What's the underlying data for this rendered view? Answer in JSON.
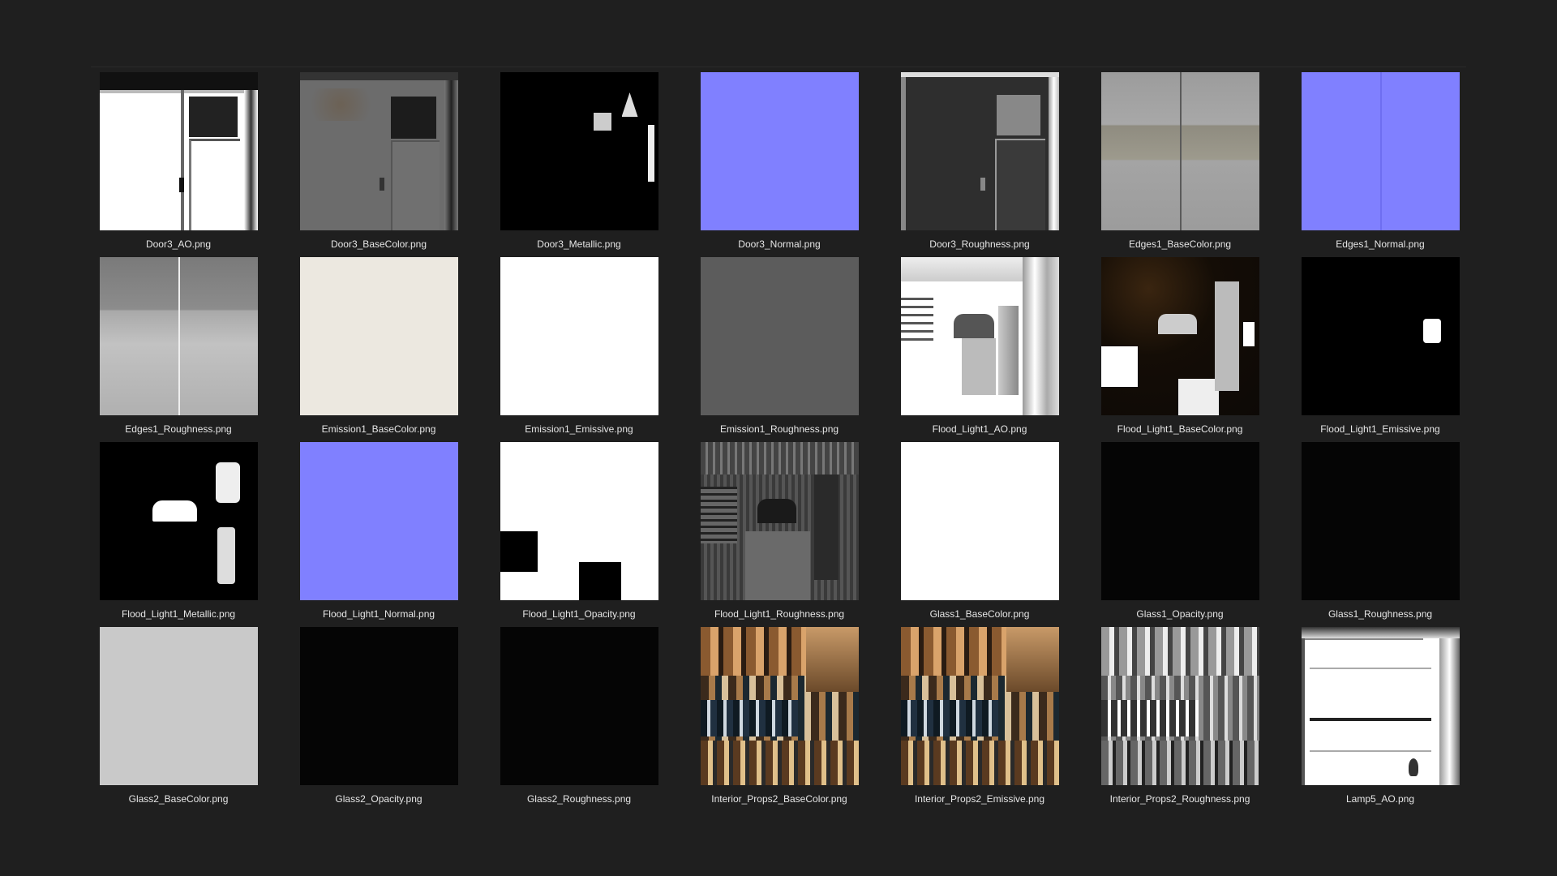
{
  "gallery": {
    "items": [
      {
        "name": "Door3_AO.png",
        "look": "door-ao"
      },
      {
        "name": "Door3_BaseColor.png",
        "look": "door-base"
      },
      {
        "name": "Door3_Metallic.png",
        "look": "door-metal"
      },
      {
        "name": "Door3_Normal.png",
        "look": "normal"
      },
      {
        "name": "Door3_Roughness.png",
        "look": "door-rough"
      },
      {
        "name": "Edges1_BaseColor.png",
        "look": "concrete"
      },
      {
        "name": "Edges1_Normal.png",
        "look": "normal-line"
      },
      {
        "name": "Edges1_Roughness.png",
        "look": "rough-concrete"
      },
      {
        "name": "Emission1_BaseColor.png",
        "look": "cream"
      },
      {
        "name": "Emission1_Emissive.png",
        "look": "white"
      },
      {
        "name": "Emission1_Roughness.png",
        "look": "midgray"
      },
      {
        "name": "Flood_Light1_AO.png",
        "look": "flood-ao"
      },
      {
        "name": "Flood_Light1_BaseColor.png",
        "look": "flood-base"
      },
      {
        "name": "Flood_Light1_Emissive.png",
        "look": "flood-emissive"
      },
      {
        "name": "Flood_Light1_Metallic.png",
        "look": "flood-metal"
      },
      {
        "name": "Flood_Light1_Normal.png",
        "look": "normal"
      },
      {
        "name": "Flood_Light1_Opacity.png",
        "look": "flood-opacity"
      },
      {
        "name": "Flood_Light1_Roughness.png",
        "look": "flood-rough"
      },
      {
        "name": "Glass1_BaseColor.png",
        "look": "white"
      },
      {
        "name": "Glass1_Opacity.png",
        "look": "nearblack"
      },
      {
        "name": "Glass1_Roughness.png",
        "look": "nearblack"
      },
      {
        "name": "Glass2_BaseColor.png",
        "look": "lightgray"
      },
      {
        "name": "Glass2_Opacity.png",
        "look": "nearblack"
      },
      {
        "name": "Glass2_Roughness.png",
        "look": "nearblack"
      },
      {
        "name": "Interior_Props2_BaseColor.png",
        "look": "props-color"
      },
      {
        "name": "Interior_Props2_Emissive.png",
        "look": "props-color"
      },
      {
        "name": "Interior_Props2_Roughness.png",
        "look": "props-rough"
      },
      {
        "name": "Lamp5_AO.png",
        "look": "lamp-ao"
      }
    ]
  }
}
